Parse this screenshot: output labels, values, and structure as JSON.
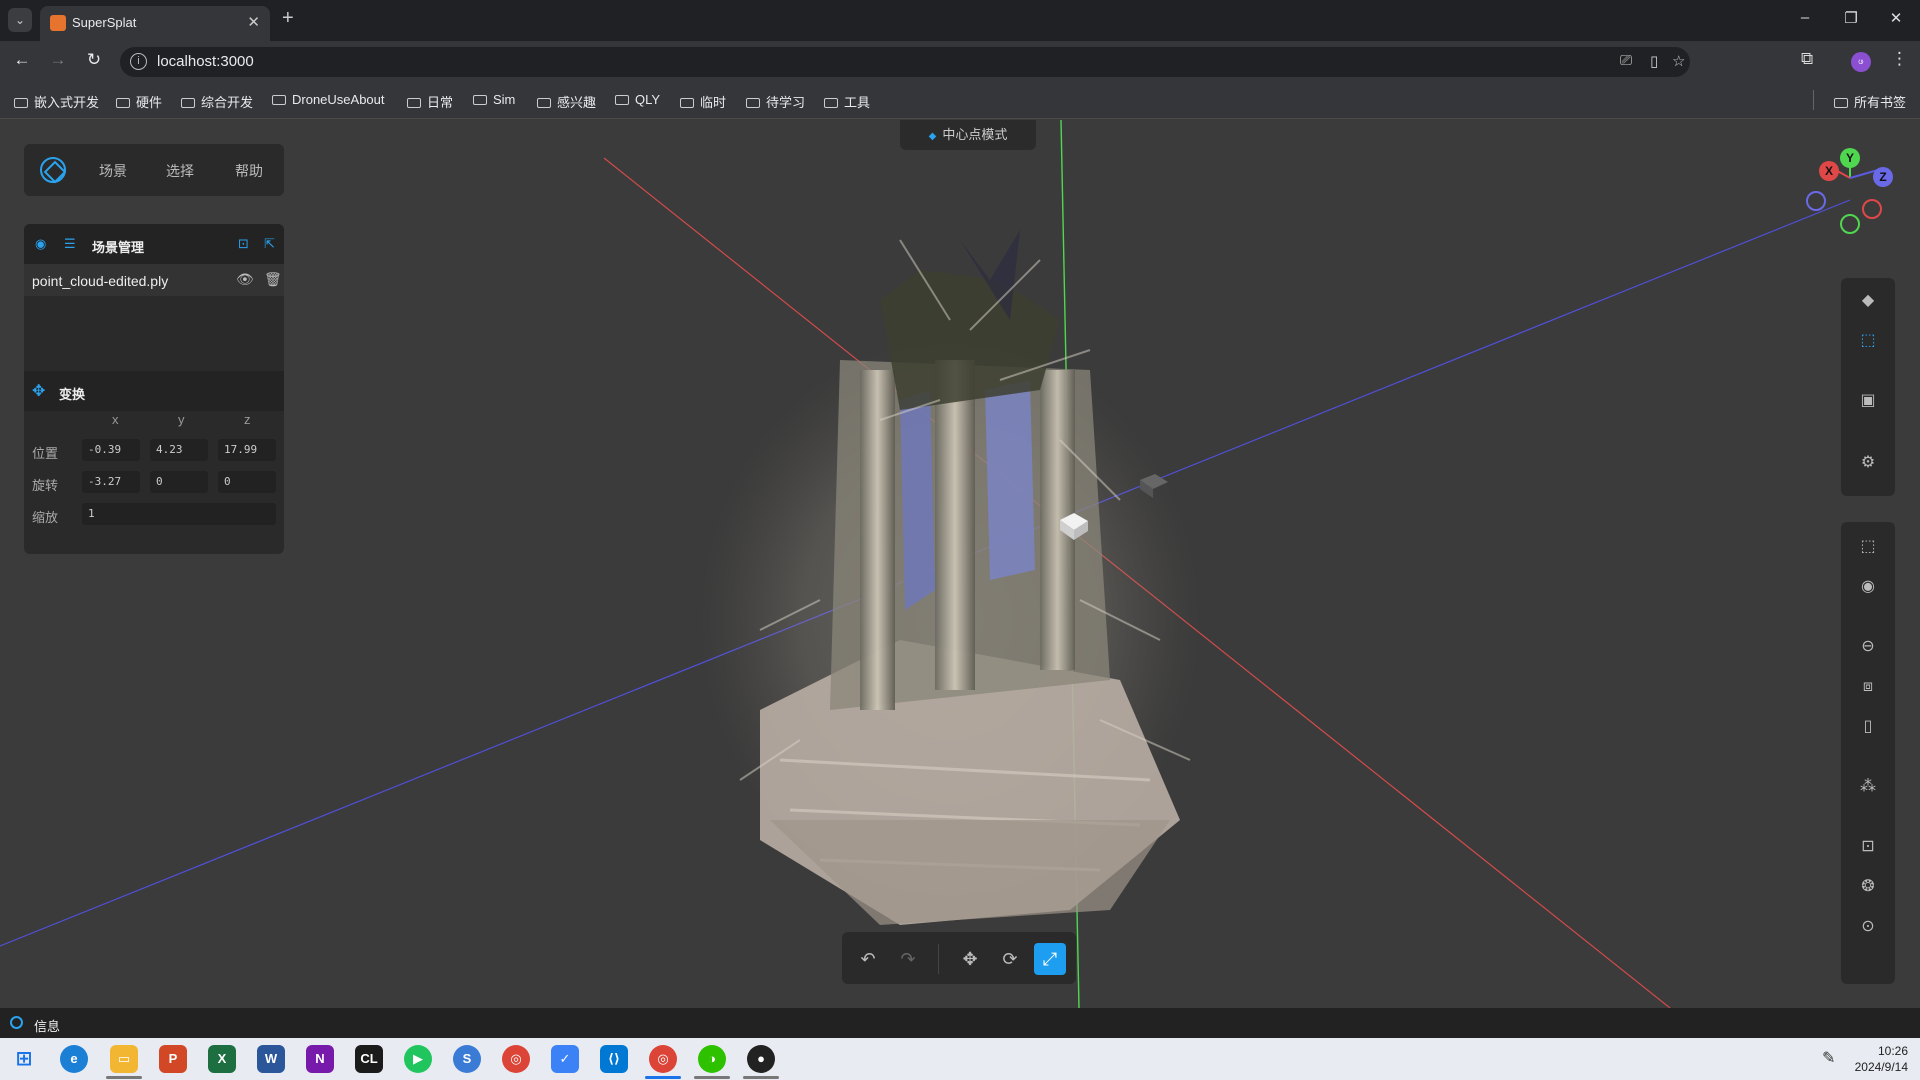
{
  "browser": {
    "tab_title": "SuperSplat",
    "url": "localhost:3000",
    "bookmarks": [
      "嵌入式开发",
      "硬件",
      "综合开发",
      "DroneUseAbout",
      "日常",
      "Sim",
      "感兴趣",
      "QLY",
      "临时",
      "待学习",
      "工具"
    ],
    "all_bookmarks_label": "所有书签",
    "profile_initial": "ဖ"
  },
  "app": {
    "mode_label": "中心点模式",
    "menu": {
      "scene": "场景",
      "select": "选择",
      "help": "帮助"
    },
    "scene_manager": {
      "title": "场景管理",
      "file_name": "point_cloud-edited.ply"
    },
    "transform": {
      "title": "变换",
      "axes": [
        "x",
        "y",
        "z"
      ],
      "position_label": "位置",
      "rotation_label": "旋转",
      "scale_label": "缩放",
      "position": [
        "-0.39",
        "4.23",
        "17.99"
      ],
      "rotation": [
        "-3.27",
        "0",
        "0"
      ],
      "scale": "1"
    },
    "gizmo": {
      "x": "X",
      "y": "Y",
      "z": "Z"
    },
    "info_label": "信息"
  },
  "icons": {
    "right_toolbar_top": [
      "diamond-icon",
      "focus-select-icon",
      "frame-icon",
      "gear-icon"
    ],
    "right_toolbar_bottom": [
      "rect-select-icon",
      "brush-select-icon",
      "sphere-select-icon",
      "box-select-icon",
      "cylinder-select-icon",
      "splat-icon",
      "center-icon",
      "cube-icon",
      "reset-icon"
    ],
    "bottom_toolbar": [
      "undo-icon",
      "redo-icon",
      "move-icon",
      "rotate-icon",
      "scale-icon"
    ]
  },
  "taskbar": {
    "time": "10:26",
    "date": "2024/9/14"
  },
  "colors": {
    "accent": "#2aa3ef",
    "axis_x": "#e04848",
    "axis_y": "#4fd84f",
    "axis_z": "#5a5ae0"
  }
}
